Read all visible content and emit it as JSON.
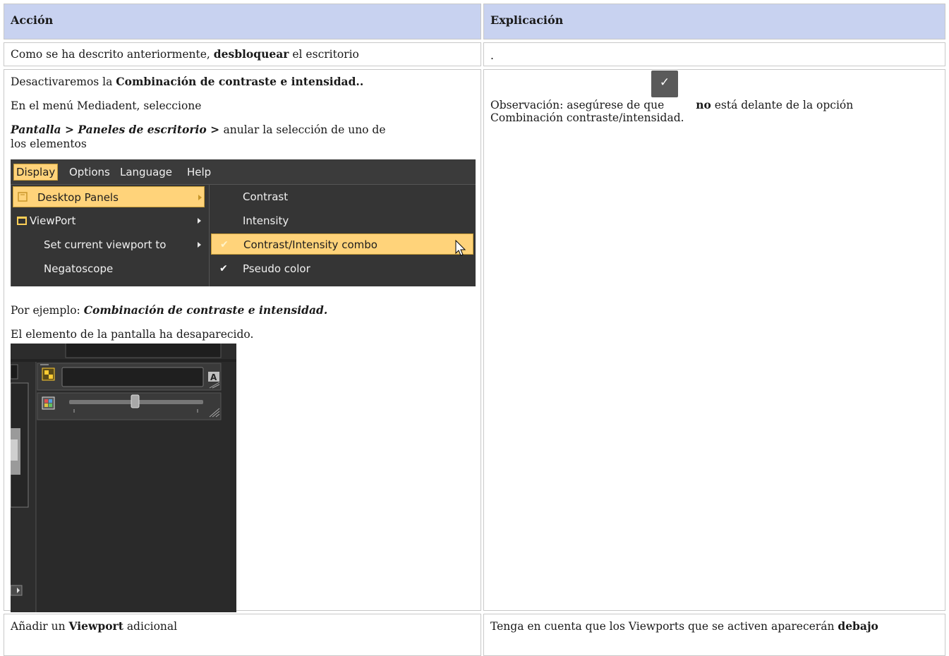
{
  "table": {
    "header": {
      "col1": "Acción",
      "col2": "Explicación"
    },
    "row1": {
      "action_pre": "Como se ha descrito anteriormente, ",
      "action_bold": "desbloquear",
      "action_post": " el escritorio",
      "explanation": "."
    },
    "row2": {
      "line1_pre": "Desactivaremos la ",
      "line1_bold": "Combinación de contraste e intensidad..",
      "line2": "En el menú Mediadent, seleccione",
      "path_1": "Pantalla",
      "path_sep1": " > ",
      "path_2": "Paneles de escritorio",
      "path_sep2": " > ",
      "path_rest_1": "anular la selección de uno de",
      "path_rest_2": "los elementos",
      "example_pre": "Por ejemplo: ",
      "example_bold": "Combinación de contraste e intensidad.",
      "disappeared": "El elemento de la pantalla ha desaparecido.",
      "obs_pre": "Observación: asegúrese de que ",
      "obs_bold": "no",
      "obs_post": " está delante de la opción",
      "obs_line2": "Combinación contraste/intensidad.",
      "check_icon": "check-icon"
    },
    "row3": {
      "action_pre": "Añadir un ",
      "action_bold": "Viewport",
      "action_post": " adicional",
      "explanation_pre": "Tenga en cuenta que los Viewports que se activen aparecerán ",
      "explanation_bold": "debajo"
    }
  },
  "menu_screenshot": {
    "menubar": [
      "Display",
      "Options",
      "Language",
      "Help"
    ],
    "left_menu": [
      "Desktop Panels",
      "ViewPort",
      "Set current viewport to",
      "Negatoscope"
    ],
    "sub_menu": [
      "Contrast",
      "Intensity",
      "Contrast/Intensity combo",
      "Pseudo color"
    ],
    "colors": {
      "highlight": "#ffd37a",
      "background": "#2e2e2e"
    }
  },
  "panel_screenshot": {
    "auto_label": "A"
  }
}
